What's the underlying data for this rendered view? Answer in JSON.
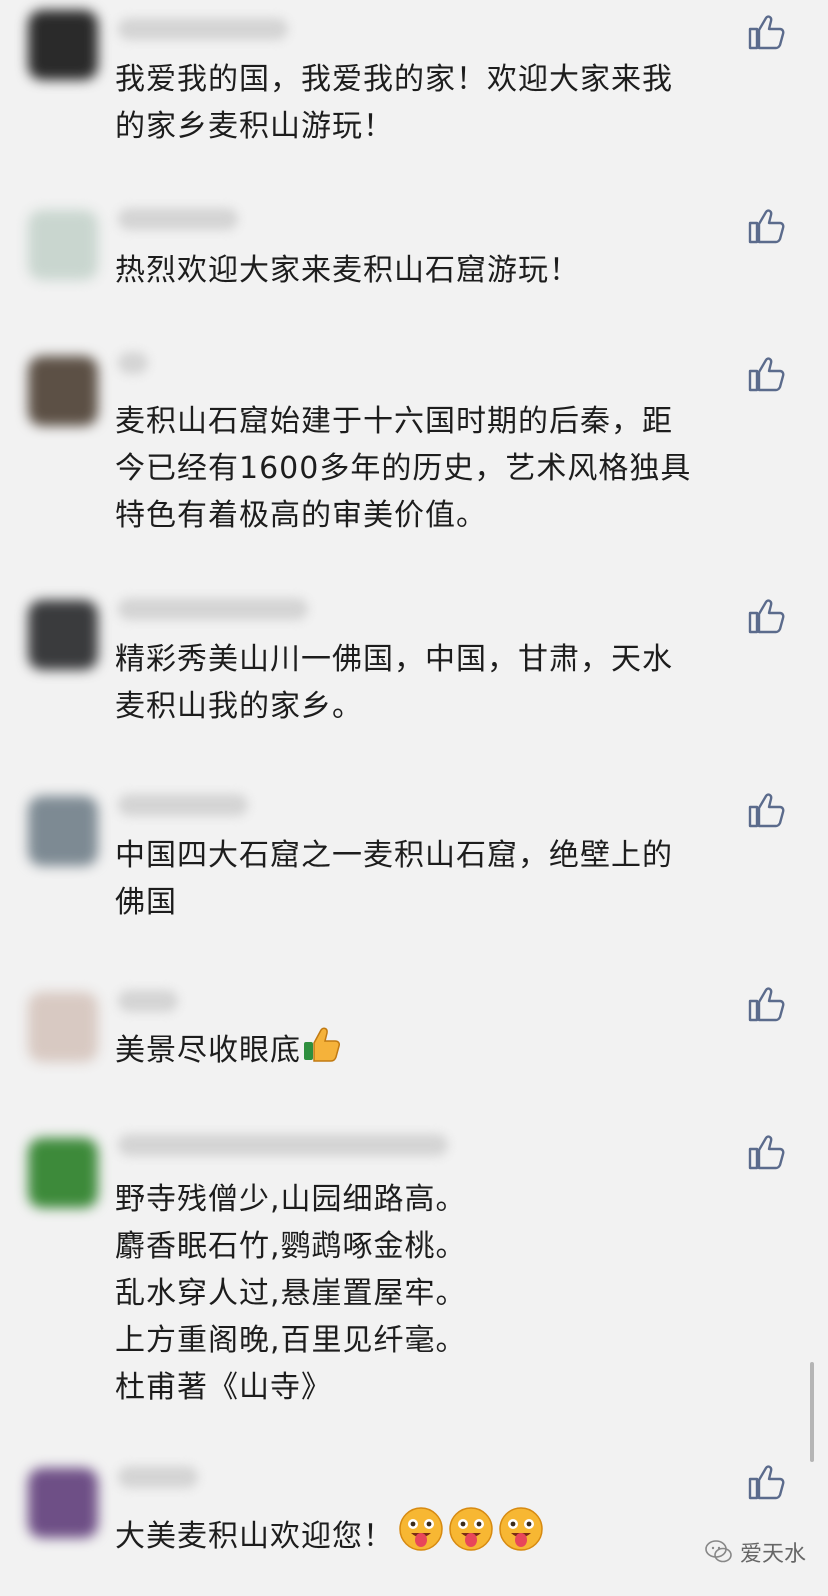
{
  "comments": [
    {
      "text": "我爱我的国，我爱我的家！欢迎大家来我\n的家乡麦积山游玩！",
      "avatar_color": "#2a2a2a"
    },
    {
      "text": "热烈欢迎大家来麦积山石窟游玩！",
      "avatar_color": "#c9d6cf"
    },
    {
      "text": "麦积山石窟始建于十六国时期的后秦，距\n今已经有1600多年的历史，艺术风格独具\n特色有着极高的审美价值。",
      "avatar_color": "#5c5045"
    },
    {
      "text": "精彩秀美山川一佛国，中国，甘肃，天水\n麦积山我的家乡。",
      "avatar_color": "#3a3b3d"
    },
    {
      "text": "中国四大石窟之一麦积山石窟，绝壁上的\n佛国",
      "avatar_color": "#7d8a93"
    },
    {
      "text": "美景尽收眼底",
      "avatar_color": "#d8c9c2",
      "emoji": "thumbs-up-emoji"
    },
    {
      "text": "野寺残僧少,山园细路高。\n麝香眠石竹,鹦鹉啄金桃。\n乱水穿人过,悬崖置屋牢。\n上方重阁晚,百里见纤毫。\n杜甫著《山寺》",
      "avatar_color": "#3d8a3a"
    },
    {
      "text": "大美麦积山欢迎您！",
      "avatar_color": "#6e4f86",
      "emoji": "tongue-face-emoji"
    }
  ],
  "icons": {
    "like": "thumbs-up-outline-icon",
    "watermark": "wechat-icon"
  },
  "watermark": {
    "label": "爱天水"
  },
  "colors": {
    "background": "#f2f2f2",
    "text": "#1d1d1d",
    "like_icon": "#5b6b8c"
  }
}
